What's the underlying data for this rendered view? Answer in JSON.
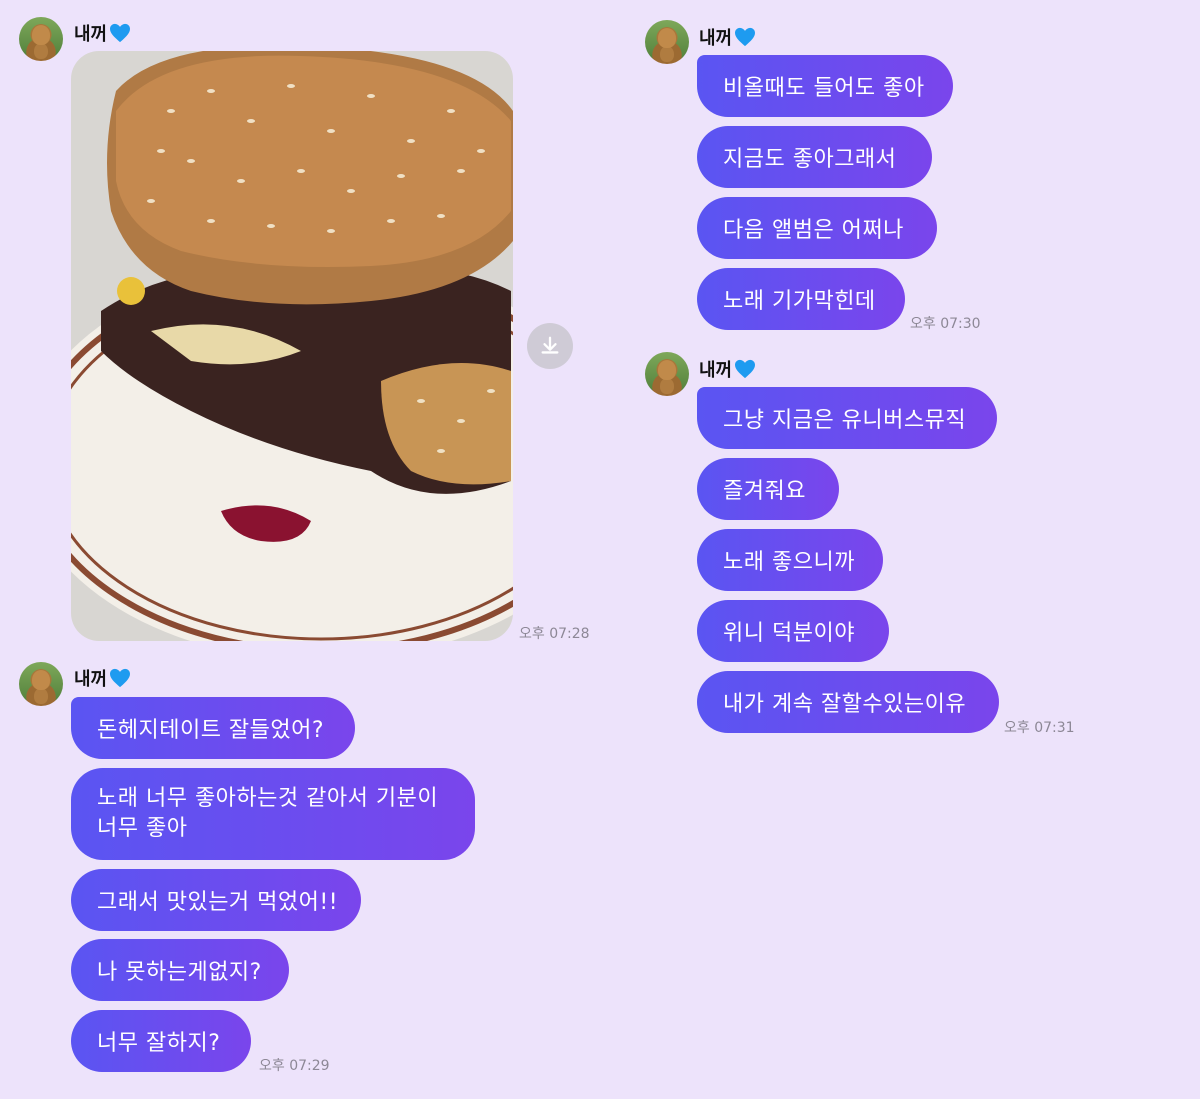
{
  "left": {
    "group1": {
      "sender": "내꺼",
      "photo_time": "오후 07:28"
    },
    "group2": {
      "sender": "내꺼",
      "messages": [
        "돈헤지테이트 잘들었어?",
        "노래 너무 좋아하는것 같아서 기분이 너무 좋아",
        "그래서 맛있는거 먹었어!!",
        "나 못하는게없지?",
        "너무 잘하지?"
      ],
      "time": "오후 07:29"
    }
  },
  "right": {
    "group1": {
      "sender": "내꺼",
      "messages": [
        "비올때도 들어도 좋아",
        "지금도 좋아그래서",
        "다음 앨범은 어쩌나",
        "노래 기가막힌데"
      ],
      "time": "오후 07:30"
    },
    "group2": {
      "sender": "내꺼",
      "messages": [
        "그냥 지금은 유니버스뮤직",
        "즐겨줘요",
        "노래 좋으니까",
        "위니 덕분이야",
        "내가 계속 잘할수있는이유"
      ],
      "time": "오후 07:31"
    }
  },
  "icons": {
    "heart": "blue-heart-icon",
    "download": "download-icon"
  },
  "colors": {
    "background": "#ede3fb",
    "bubble_start": "#5a55f2",
    "bubble_end": "#7a45ec",
    "heart": "#1e9bf0"
  }
}
